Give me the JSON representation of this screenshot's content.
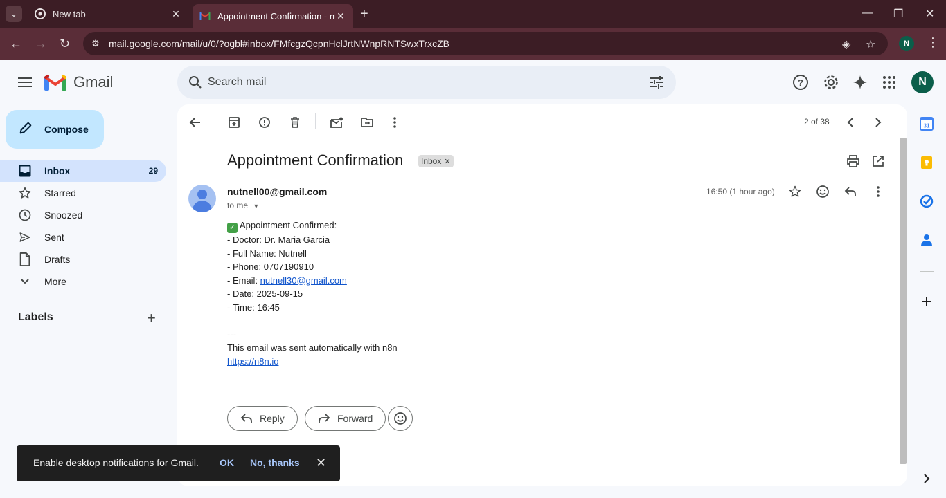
{
  "browser": {
    "tabs": [
      {
        "title": "New tab"
      },
      {
        "title": "Appointment Confirmation - nu"
      }
    ],
    "url": "mail.google.com/mail/u/0/?ogbl#inbox/FMfcgzQcpnHclJrtNWnpRNTSwxTrxcZB",
    "profile_initial": "N"
  },
  "gmail": {
    "app_name": "Gmail",
    "search_placeholder": "Search mail",
    "avatar_initial": "N"
  },
  "nav": {
    "compose_label": "Compose",
    "items": [
      {
        "label": "Inbox",
        "count": "29"
      },
      {
        "label": "Starred"
      },
      {
        "label": "Snoozed"
      },
      {
        "label": "Sent"
      },
      {
        "label": "Drafts"
      },
      {
        "label": "More"
      }
    ],
    "labels_header": "Labels"
  },
  "message": {
    "pager": "2 of 38",
    "subject": "Appointment Confirmation",
    "label_chip": "Inbox",
    "sender": "nutnell00@gmail.com",
    "to": "to me",
    "time": "16:50 (1 hour ago)",
    "body": {
      "line1": "Appointment Confirmed:",
      "doctor": "- Doctor: Dr. Maria Garcia",
      "name": "- Full Name: Nutnell",
      "phone": "- Phone: 0707190910",
      "email_prefix": "- Email: ",
      "email_link": "nutnell30@gmail.com",
      "date": "- Date: 2025-09-15",
      "time": "- Time: 16:45",
      "sep": "---",
      "footer": "This email was sent automatically with n8n",
      "footer_link": "https://n8n.io"
    },
    "reply_label": "Reply",
    "forward_label": "Forward"
  },
  "snackbar": {
    "message": "Enable desktop notifications for Gmail.",
    "ok": "OK",
    "no": "No, thanks"
  },
  "colors": {
    "chrome_dark": "#3c1d25",
    "chrome_bar": "#5a2d38",
    "compose_bg": "#c2e7ff",
    "inbox_active": "#d3e3fd",
    "link": "#1155cc",
    "avatar": "#0b5e4a"
  }
}
